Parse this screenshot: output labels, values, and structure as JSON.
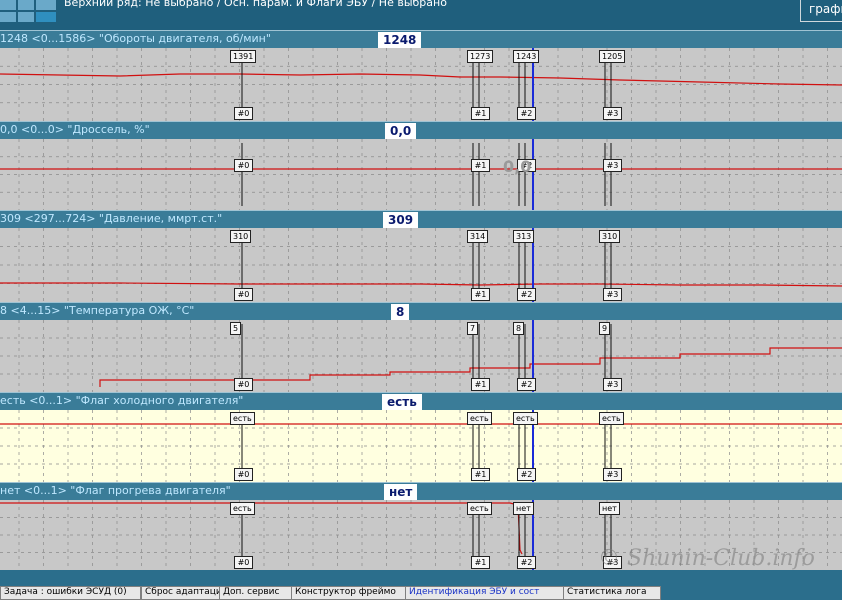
{
  "header": {
    "title": "Верхний ряд: Не выбрано / Осн. парам. и Флаги ЭБУ / Не выбрано",
    "graph_button": "графи"
  },
  "channels": [
    {
      "label": "1248   <0...1586>  \"Обороты двигателя, об/мин\"",
      "value": "1248",
      "bg": "#c8c8c8",
      "markers": [
        "1391",
        "1273",
        "1243",
        "1205"
      ]
    },
    {
      "label": "0,0   <0...0>  \"Дроссель, %\"",
      "value": "0,0",
      "bg": "#c8c8c8",
      "markers": [
        "",
        "",
        "",
        ""
      ],
      "overlay": "0,0"
    },
    {
      "label": "309   <297...724>  \"Давление, ммрт.ст.\"",
      "value": "309",
      "bg": "#c8c8c8",
      "markers": [
        "310",
        "314",
        "313",
        "310"
      ]
    },
    {
      "label": "8   <4...15>  \"Температура ОЖ, °С\"",
      "value": "8",
      "bg": "#c8c8c8",
      "markers": [
        "5",
        "7",
        "8",
        "9"
      ]
    },
    {
      "label": "есть   <0...1>  \"Флаг холодного двигателя\"",
      "value": "есть",
      "bg": "#ffffe0",
      "markers": [
        "есть",
        "есть",
        "есть",
        "есть"
      ]
    },
    {
      "label": "нет   <0...1>  \"Флаг прогрева двигателя\"",
      "value": "нет",
      "bg": "#c8c8c8",
      "markers": [
        "есть",
        "есть",
        "нет",
        "нет"
      ]
    }
  ],
  "marker_labels": [
    "#0",
    "#1",
    "#2",
    "#3"
  ],
  "tabs": [
    {
      "label": "Задача : ошибки ЭСУД (0)"
    },
    {
      "label": "Сброс адаптаци"
    },
    {
      "label": "Доп. сервис"
    },
    {
      "label": "Конструктор фреймо"
    },
    {
      "label": "Идентификация ЭБУ и сост",
      "active": true
    },
    {
      "label": "Статистика лога"
    }
  ],
  "watermark": "© Shunin-Club.info",
  "colors": {
    "trace": "#d01010",
    "cursor": "#1a2bd8",
    "grid": "#8a8a8a"
  }
}
